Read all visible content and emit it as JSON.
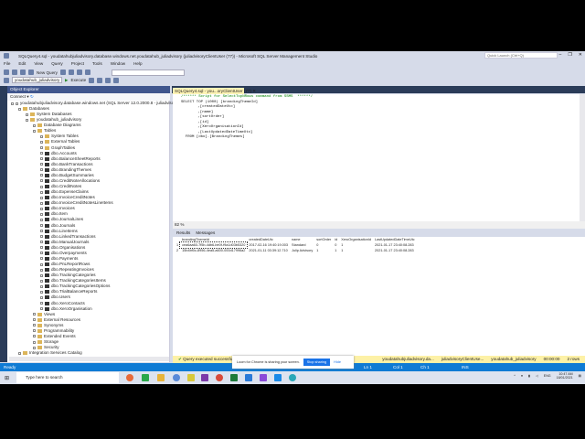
{
  "window": {
    "title": "SQLQuery4.sql - youdatahubjuliadvisory.database.windows.net.youdatahub_juliadvisory (juliadvisoryClientUser (77)) - Microsoft SQL Server Management Studio",
    "quick_launch": "Quick Launch (Ctrl+Q)"
  },
  "menu": [
    "File",
    "Edit",
    "View",
    "Query",
    "Project",
    "Tools",
    "Window",
    "Help"
  ],
  "toolbar": {
    "new_query": "New Query",
    "database": "youdatahub_juliadvisory",
    "execute": "Execute"
  },
  "object_explorer": {
    "title": "Object Explorer",
    "connect": "Connect ▾",
    "tree": [
      {
        "l": 0,
        "t": "s",
        "label": "youdatahubjuliadvisory.database.windows.net (SQL Server 12.0.2000.8 - juliadvisoryClie"
      },
      {
        "l": 1,
        "t": "f",
        "label": "Databases"
      },
      {
        "l": 2,
        "t": "f",
        "label": "System Databases"
      },
      {
        "l": 2,
        "t": "d",
        "label": "youdatahub_juliadvisory"
      },
      {
        "l": 3,
        "t": "f",
        "label": "Database Diagrams"
      },
      {
        "l": 3,
        "t": "f",
        "label": "Tables"
      },
      {
        "l": 4,
        "t": "f",
        "label": "System Tables"
      },
      {
        "l": 4,
        "t": "f",
        "label": "External Tables"
      },
      {
        "l": 4,
        "t": "f",
        "label": "GraphTables"
      },
      {
        "l": 4,
        "t": "t",
        "label": "dbo.Accounts"
      },
      {
        "l": 4,
        "t": "t",
        "label": "dbo.BalanceSheetReports"
      },
      {
        "l": 4,
        "t": "t",
        "label": "dbo.BankTransactions"
      },
      {
        "l": 4,
        "t": "t",
        "label": "dbo.BrandingThemes"
      },
      {
        "l": 4,
        "t": "t",
        "label": "dbo.BudgetSummaries"
      },
      {
        "l": 4,
        "t": "t",
        "label": "dbo.CreditNoteAllocations"
      },
      {
        "l": 4,
        "t": "t",
        "label": "dbo.CreditNotes"
      },
      {
        "l": 4,
        "t": "t",
        "label": "dbo.ExpenseClaims"
      },
      {
        "l": 4,
        "t": "t",
        "label": "dbo.InvoiceCreditNotes"
      },
      {
        "l": 4,
        "t": "t",
        "label": "dbo.InvoiceCreditNotesLineItems"
      },
      {
        "l": 4,
        "t": "t",
        "label": "dbo.Invoices"
      },
      {
        "l": 4,
        "t": "t",
        "label": "dbo.Item"
      },
      {
        "l": 4,
        "t": "t",
        "label": "dbo.JournalLines"
      },
      {
        "l": 4,
        "t": "t",
        "label": "dbo.Journals"
      },
      {
        "l": 4,
        "t": "t",
        "label": "dbo.LineItems"
      },
      {
        "l": 4,
        "t": "t",
        "label": "dbo.LinkedTransactions"
      },
      {
        "l": 4,
        "t": "t",
        "label": "dbo.ManualJournals"
      },
      {
        "l": 4,
        "t": "t",
        "label": "dbo.Organisations"
      },
      {
        "l": 4,
        "t": "t",
        "label": "dbo.Overpayments"
      },
      {
        "l": 4,
        "t": "t",
        "label": "dbo.Payments"
      },
      {
        "l": 4,
        "t": "t",
        "label": "dbo.PnLReportRows"
      },
      {
        "l": 4,
        "t": "t",
        "label": "dbo.RepeatingInvoices"
      },
      {
        "l": 4,
        "t": "t",
        "label": "dbo.TrackingCategories"
      },
      {
        "l": 4,
        "t": "t",
        "label": "dbo.TrackingCategoriesItems"
      },
      {
        "l": 4,
        "t": "t",
        "label": "dbo.TrackingCategoriesOptions"
      },
      {
        "l": 4,
        "t": "t",
        "label": "dbo.TrialBalanceReports"
      },
      {
        "l": 4,
        "t": "t",
        "label": "dbo.Users"
      },
      {
        "l": 4,
        "t": "t",
        "label": "dbo.XeroContacts"
      },
      {
        "l": 4,
        "t": "t",
        "label": "dbo.XeroOrganisation"
      },
      {
        "l": 3,
        "t": "f",
        "label": "Views"
      },
      {
        "l": 3,
        "t": "f",
        "label": "External Resources"
      },
      {
        "l": 3,
        "t": "f",
        "label": "Synonyms"
      },
      {
        "l": 3,
        "t": "f",
        "label": "Programmability"
      },
      {
        "l": 3,
        "t": "f",
        "label": "Extended Events"
      },
      {
        "l": 3,
        "t": "f",
        "label": "Storage"
      },
      {
        "l": 3,
        "t": "f",
        "label": "Security"
      },
      {
        "l": 1,
        "t": "f",
        "label": "Integration Services Catalog"
      }
    ]
  },
  "editor": {
    "tab": "SQLQuery4.sql - you...oryClientUser (77)",
    "lines": [
      "/****** Script for SelectTopNRows command from SSMS  ******/",
      "SELECT TOP (1000) [brandingThemeId]",
      "      ,[createdDateUtc]",
      "      ,[name]",
      "      ,[sortOrder]",
      "      ,[id]",
      "      ,[XeroOrganisationId]",
      "      ,[LastUpdatedDateTimeUtc]",
      "  FROM [dbo].[BrandingThemes]"
    ]
  },
  "results": {
    "zoom": "82 %",
    "tabs": [
      "Results",
      "Messages"
    ],
    "columns": [
      "",
      "brandingThemeId",
      "createdDateUtc",
      "name",
      "sortOrder",
      "id",
      "XeroOrganisationId",
      "LastUpdatedDateTimeUtc"
    ],
    "rows": [
      [
        "1",
        "cea6aa60-7f5b-4db6-be0f-f9a1d03b5320",
        "2017-02-16 19:40:19.003",
        "Standard",
        "0",
        "0",
        "1",
        "2021-01-17 23:40:08.283"
      ],
      [
        "2",
        "15b4bf0c-8956-4ea5-a600-000d17996a2",
        "2021-01-11 03:39:12.710",
        "Julip Advisory",
        "1",
        "1",
        "1",
        "2021-01-17 23:40:08.283"
      ]
    ]
  },
  "query_status": {
    "message": "Query executed successfully.",
    "server": "youdatahubjuliadvisory.da...",
    "user": "juliadvisoryClientUse...",
    "db": "youdatahub_juliadvisory",
    "time": "00:00:00",
    "rows": "2 rows"
  },
  "share_banner": {
    "text": "Loom for Chrome is sharing your screen.",
    "stop": "Stop sharing",
    "hide": "Hide"
  },
  "status": {
    "ready": "Ready",
    "ln": "Ln 1",
    "col": "Col 1",
    "ch": "Ch 1",
    "ins": "INS"
  },
  "taskbar": {
    "search": "Type here to search",
    "lang": "ENG",
    "time": "10:47 AM",
    "date": "18/01/2021"
  },
  "colors": {
    "accent": "#0f7bd4",
    "panel_header": "#40568d",
    "tab_active": "#fff4b5"
  }
}
